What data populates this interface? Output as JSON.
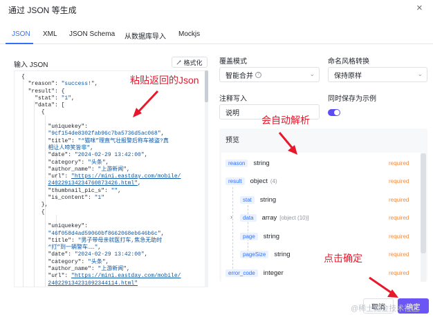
{
  "dialog": {
    "title": "通过 JSON 等生成",
    "close_glyph": "×"
  },
  "tabs": [
    {
      "label": "JSON",
      "active": true
    },
    {
      "label": "XML"
    },
    {
      "label": "JSON Schema"
    },
    {
      "label": "从数据库导入"
    },
    {
      "label": "Mockjs"
    }
  ],
  "left": {
    "label": "输入 JSON",
    "format_label": "格式化",
    "format_icon": "magic-wand-icon"
  },
  "code_lines": [
    {
      "segs": [
        {
          "t": "{",
          "c": "k"
        }
      ]
    },
    {
      "segs": [
        {
          "t": "  \"reason\": ",
          "c": "k"
        },
        {
          "t": "\"success!\"",
          "c": "s"
        },
        {
          "t": ",",
          "c": "k"
        }
      ]
    },
    {
      "segs": [
        {
          "t": "  \"result\": {",
          "c": "k"
        }
      ]
    },
    {
      "segs": [
        {
          "t": "    \"stat\": ",
          "c": "k"
        },
        {
          "t": "\"1\"",
          "c": "s"
        },
        {
          "t": ",",
          "c": "k"
        }
      ]
    },
    {
      "segs": [
        {
          "t": "    \"data\": [",
          "c": "k"
        }
      ]
    },
    {
      "segs": [
        {
          "t": "      {",
          "c": "k"
        }
      ]
    },
    {
      "segs": [
        {
          "t": "",
          "c": "k"
        }
      ]
    },
    {
      "segs": [
        {
          "t": "        \"uniquekey\":",
          "c": "k"
        }
      ]
    },
    {
      "segs": [
        {
          "t": "        ",
          "c": "k"
        },
        {
          "t": "\"9cf154de8302fab96c7ba5736d5ac068\"",
          "c": "s"
        },
        {
          "t": ",",
          "c": "k"
        }
      ]
    },
    {
      "segs": [
        {
          "t": "        \"title\": ",
          "c": "k"
        },
        {
          "t": "\"“猫咪”理直气壮报警后称车被盗?真",
          "c": "s"
        }
      ]
    },
    {
      "segs": [
        {
          "t": "        ",
          "c": "k"
        },
        {
          "t": "相让人啼笑皆非\"",
          "c": "s"
        },
        {
          "t": ",",
          "c": "k"
        }
      ]
    },
    {
      "segs": [
        {
          "t": "        \"date\": ",
          "c": "k"
        },
        {
          "t": "\"2024-02-29 13:42:00\"",
          "c": "s"
        },
        {
          "t": ",",
          "c": "k"
        }
      ]
    },
    {
      "segs": [
        {
          "t": "        \"category\": ",
          "c": "k"
        },
        {
          "t": "\"头条\"",
          "c": "s"
        },
        {
          "t": ",",
          "c": "k"
        }
      ]
    },
    {
      "segs": [
        {
          "t": "        \"author_name\": ",
          "c": "k"
        },
        {
          "t": "\"上游新闻\"",
          "c": "s"
        },
        {
          "t": ",",
          "c": "k"
        }
      ]
    },
    {
      "segs": [
        {
          "t": "        \"url\": ",
          "c": "k"
        },
        {
          "t": "\"https://mini.eastday.com/mobile/",
          "c": "u"
        }
      ]
    },
    {
      "segs": [
        {
          "t": "        ",
          "c": "k"
        },
        {
          "t": "240229134234760873426.html\"",
          "c": "u"
        },
        {
          "t": ",",
          "c": "k"
        }
      ]
    },
    {
      "segs": [
        {
          "t": "        \"thumbnail_pic_s\": ",
          "c": "k"
        },
        {
          "t": "\"\"",
          "c": "s"
        },
        {
          "t": ",",
          "c": "k"
        }
      ]
    },
    {
      "segs": [
        {
          "t": "        \"is_content\": ",
          "c": "k"
        },
        {
          "t": "\"1\"",
          "c": "s"
        }
      ]
    },
    {
      "segs": [
        {
          "t": "      },",
          "c": "k"
        }
      ]
    },
    {
      "segs": [
        {
          "t": "      {",
          "c": "k"
        }
      ]
    },
    {
      "segs": [
        {
          "t": "",
          "c": "k"
        }
      ]
    },
    {
      "segs": [
        {
          "t": "        \"uniquekey\":",
          "c": "k"
        }
      ]
    },
    {
      "segs": [
        {
          "t": "        ",
          "c": "k"
        },
        {
          "t": "\"46f058d4ad59060bf8662068eb646b6c\"",
          "c": "s"
        },
        {
          "t": ",",
          "c": "k"
        }
      ]
    },
    {
      "segs": [
        {
          "t": "        \"title\": ",
          "c": "k"
        },
        {
          "t": "\"男子带母亲就医打车,焦急无助时",
          "c": "s"
        }
      ]
    },
    {
      "segs": [
        {
          "t": "        ",
          "c": "k"
        },
        {
          "t": "“打”到一辆警车……\"",
          "c": "s"
        },
        {
          "t": ",",
          "c": "k"
        }
      ]
    },
    {
      "segs": [
        {
          "t": "        \"date\": ",
          "c": "k"
        },
        {
          "t": "\"2024-02-29 13:42:00\"",
          "c": "s"
        },
        {
          "t": ",",
          "c": "k"
        }
      ]
    },
    {
      "segs": [
        {
          "t": "        \"category\": ",
          "c": "k"
        },
        {
          "t": "\"头条\"",
          "c": "s"
        },
        {
          "t": ",",
          "c": "k"
        }
      ]
    },
    {
      "segs": [
        {
          "t": "        \"author_name\": ",
          "c": "k"
        },
        {
          "t": "\"上游新闻\"",
          "c": "s"
        },
        {
          "t": ",",
          "c": "k"
        }
      ]
    },
    {
      "segs": [
        {
          "t": "        \"url\": ",
          "c": "k"
        },
        {
          "t": "\"https://mini.eastday.com/mobile/",
          "c": "u"
        }
      ]
    },
    {
      "segs": [
        {
          "t": "        ",
          "c": "k"
        },
        {
          "t": "240229134231092344114.html\"",
          "c": "u"
        }
      ]
    }
  ],
  "right": {
    "override_label": "覆盖模式",
    "override_value": "智能合并",
    "override_info_icon": "info-icon",
    "naming_label": "命名风格转换",
    "naming_value": "保持原样",
    "comment_label": "注释写入",
    "comment_value": "说明",
    "save_example_label": "同时保存为示例",
    "save_example_on": true,
    "chevron_icon": "chevron-down-icon",
    "preview_title": "预览"
  },
  "preview_rows": [
    {
      "name": "reason",
      "type": "string",
      "required": "required"
    },
    {
      "name": "result",
      "type": "object",
      "extra": "(4)",
      "required": "required",
      "expander": "chevron-down-icon"
    },
    {
      "name": "stat",
      "type": "string",
      "required": "required"
    },
    {
      "name": "data",
      "type": "array",
      "extra": "[object (10)]",
      "required": "required",
      "expander": "chevron-right-icon"
    },
    {
      "name": "page",
      "type": "string",
      "required": "required"
    },
    {
      "name": "pageSize",
      "type": "string",
      "required": "required"
    },
    {
      "name": "error_code",
      "type": "integer",
      "required": "required"
    }
  ],
  "footer": {
    "cancel_label": "取消",
    "confirm_label": "确定"
  },
  "annotations": {
    "paste": "粘贴返回的Json",
    "auto": "会自动解析",
    "confirm": "点击确定",
    "color": "#e8172a"
  },
  "watermark": "@稀土掘金技术社区"
}
